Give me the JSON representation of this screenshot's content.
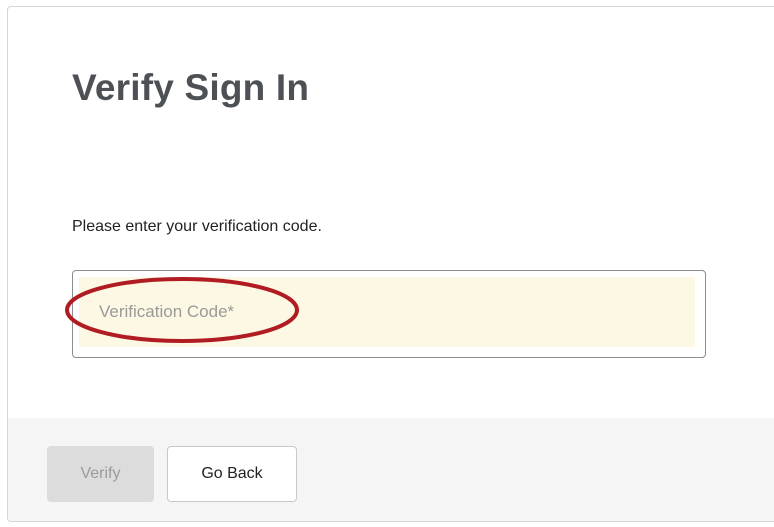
{
  "page": {
    "title": "Verify Sign In",
    "instruction": "Please enter your verification code."
  },
  "verification_field": {
    "placeholder": "Verification Code*",
    "value": "",
    "background_color": "#fdf8e4",
    "highlight_color": "#b01c22"
  },
  "actions": {
    "verify_label": "Verify",
    "verify_disabled": true,
    "go_back_label": "Go Back"
  }
}
